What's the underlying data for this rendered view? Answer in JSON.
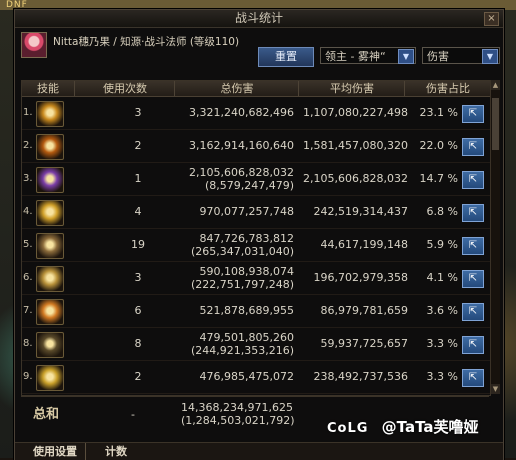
{
  "top": {
    "logo": "DNF"
  },
  "window": {
    "title": "战斗统计",
    "close": "×"
  },
  "header": {
    "character": "Nitta穗乃果 / 知源·战斗法师 (等级110)",
    "reset_label": "重置",
    "target_select": "领主 - 雾神“",
    "metric_select": "伤害"
  },
  "columns": [
    "技能",
    "使用次数",
    "总伤害",
    "平均伤害",
    "伤害占比"
  ],
  "rows": [
    {
      "idx": "1.",
      "uses": "3",
      "total": "3,321,240,682,496",
      "sub": "",
      "avg": "1,107,080,227,498",
      "pct": "23.1 %",
      "color": "#c98a1e"
    },
    {
      "idx": "2.",
      "uses": "2",
      "total": "3,162,914,160,640",
      "sub": "",
      "avg": "1,581,457,080,320",
      "pct": "22.0 %",
      "color": "#b35a0f"
    },
    {
      "idx": "3.",
      "uses": "1",
      "total": "2,105,606,828,032",
      "sub": "(8,579,247,479)",
      "avg": "2,105,606,828,032",
      "pct": "14.7 %",
      "color": "#7b3ea8"
    },
    {
      "idx": "4.",
      "uses": "4",
      "total": "970,077,257,748",
      "sub": "",
      "avg": "242,519,314,437",
      "pct": "6.8 %",
      "color": "#d1a12a"
    },
    {
      "idx": "5.",
      "uses": "19",
      "total": "847,726,783,812",
      "sub": "(265,347,031,040)",
      "avg": "44,617,199,148",
      "pct": "5.9 %",
      "color": "#8a6a3a"
    },
    {
      "idx": "6.",
      "uses": "3",
      "total": "590,108,938,074",
      "sub": "(222,751,797,248)",
      "avg": "196,702,979,358",
      "pct": "4.1 %",
      "color": "#b8913a"
    },
    {
      "idx": "7.",
      "uses": "6",
      "total": "521,878,689,955",
      "sub": "",
      "avg": "86,979,781,659",
      "pct": "3.6 %",
      "color": "#d27a22"
    },
    {
      "idx": "8.",
      "uses": "8",
      "total": "479,501,805,260",
      "sub": "(244,921,353,216)",
      "avg": "59,937,725,657",
      "pct": "3.3 %",
      "color": "#5a4a2a"
    },
    {
      "idx": "9.",
      "uses": "2",
      "total": "476,985,475,072",
      "sub": "",
      "avg": "238,492,737,536",
      "pct": "3.3 %",
      "color": "#c9a02a"
    }
  ],
  "summary": {
    "label": "总和",
    "uses": "-",
    "total": "14,368,234,971,625",
    "sub": "(1,284,503,021,792)"
  },
  "footer": {
    "tab1": "使用设置",
    "tab2": "计数"
  },
  "watermark": {
    "brand": "CoLG",
    "user": "@TaTa芙噜娅"
  }
}
